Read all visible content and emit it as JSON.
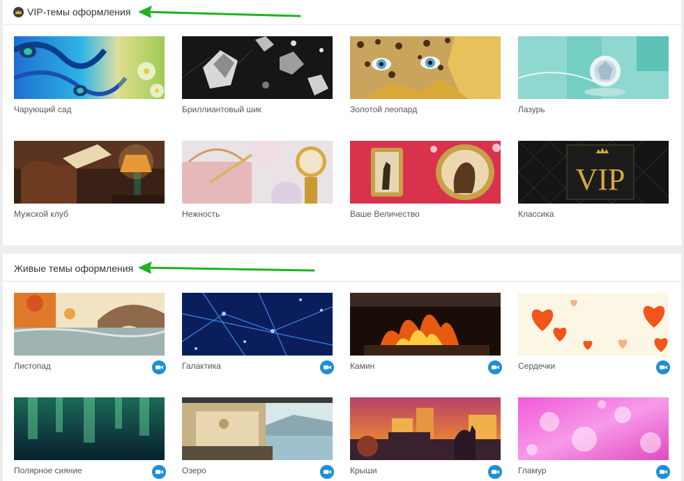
{
  "vip_section": {
    "title": "VIP-темы оформления",
    "icon": "crown-icon",
    "themes": [
      {
        "label": "Чарующий сад"
      },
      {
        "label": "Бриллиантовый шик"
      },
      {
        "label": "Золотой леопард"
      },
      {
        "label": "Лазурь"
      },
      {
        "label": "Мужской клуб"
      },
      {
        "label": "Нежность"
      },
      {
        "label": "Ваше Величество"
      },
      {
        "label": "Классика"
      }
    ]
  },
  "live_section": {
    "title": "Живые темы оформления",
    "video_icon": "video-camera-icon",
    "themes": [
      {
        "label": "Листопад"
      },
      {
        "label": "Галактика"
      },
      {
        "label": "Камин"
      },
      {
        "label": "Сердечки"
      },
      {
        "label": "Полярное сияние"
      },
      {
        "label": "Озеро"
      },
      {
        "label": "Крыши"
      },
      {
        "label": "Гламур"
      }
    ]
  },
  "colors": {
    "arrow": "#1db31d",
    "video_badge": "#1e8fd6",
    "page_background": "#ededed"
  }
}
